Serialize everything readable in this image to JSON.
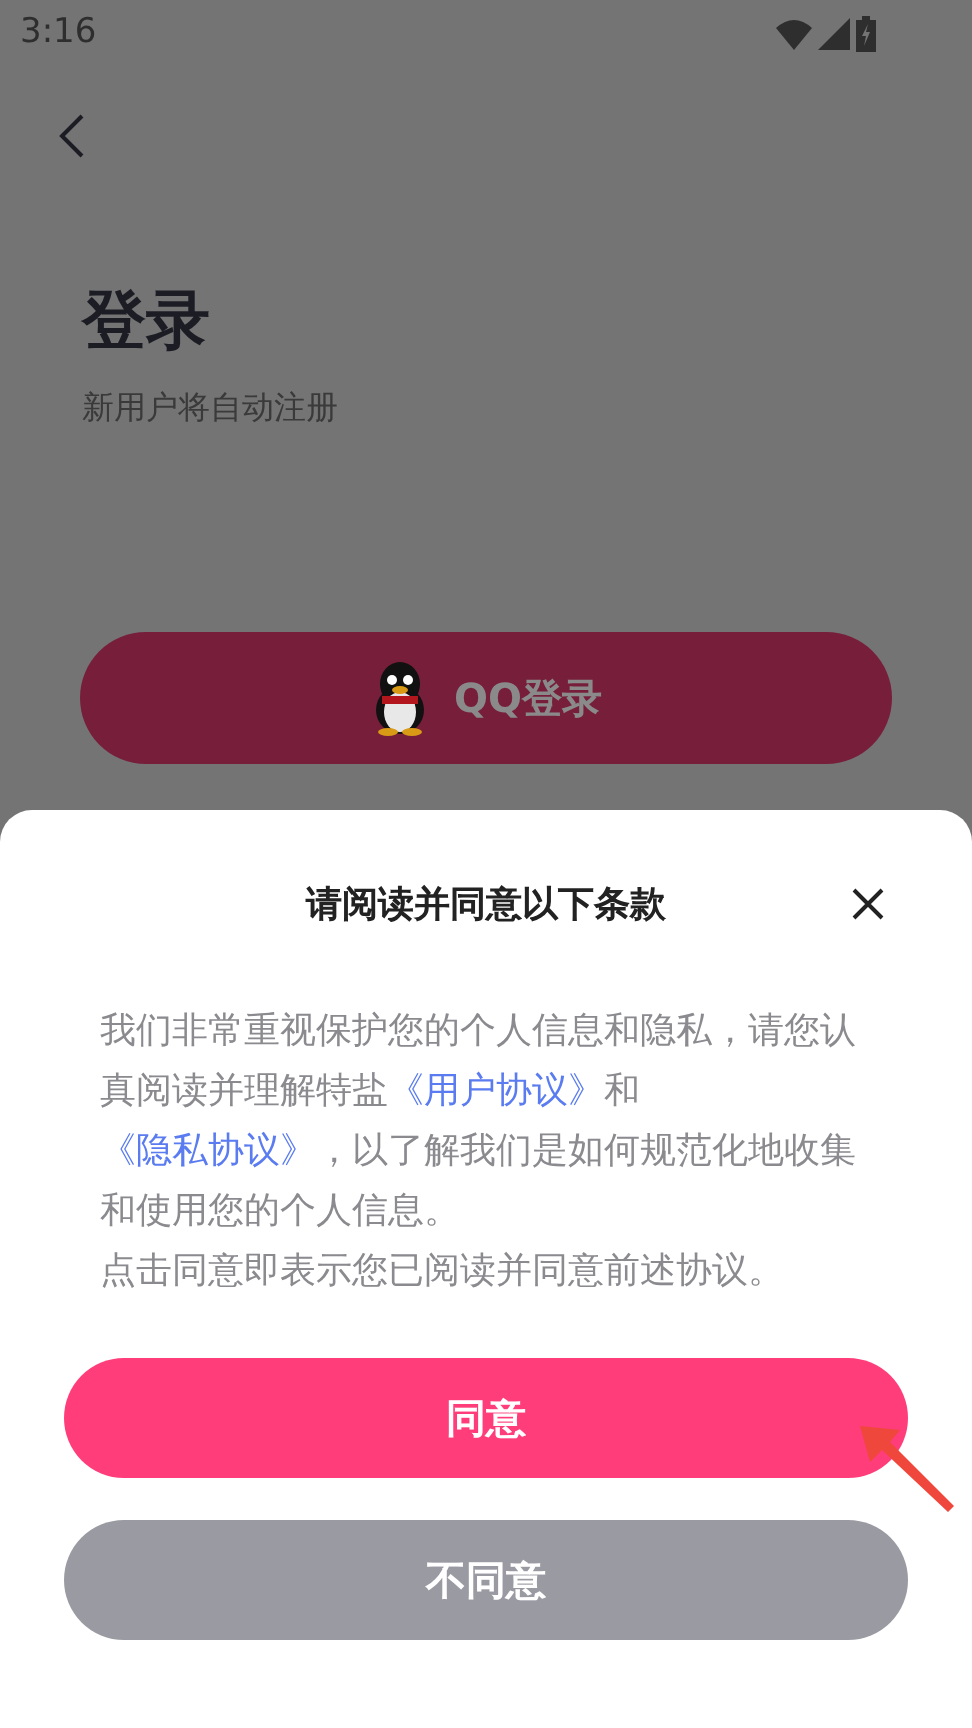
{
  "status_bar": {
    "time": "3:16"
  },
  "page": {
    "title": "登录",
    "subtitle": "新用户将自动注册",
    "qq_button": "QQ登录"
  },
  "dialog": {
    "title": "请阅读并同意以下条款",
    "body": [
      {
        "kind": "text",
        "text": "我们非常重视保护您的个人信息和隐私，请您认真阅读并理解特盐"
      },
      {
        "kind": "link",
        "text": "《用户协议》"
      },
      {
        "kind": "text",
        "text": "和"
      },
      {
        "kind": "link",
        "text": "《隐私协议》"
      },
      {
        "kind": "text",
        "text": "，以了解我们是如何规范化地收集和使用您的个人信息。"
      }
    ],
    "note": "点击同意即表示您已阅读并同意前述协议。",
    "buttons": [
      {
        "kind": "primary",
        "label": "同意"
      },
      {
        "kind": "secondary",
        "label": "不同意"
      }
    ]
  }
}
